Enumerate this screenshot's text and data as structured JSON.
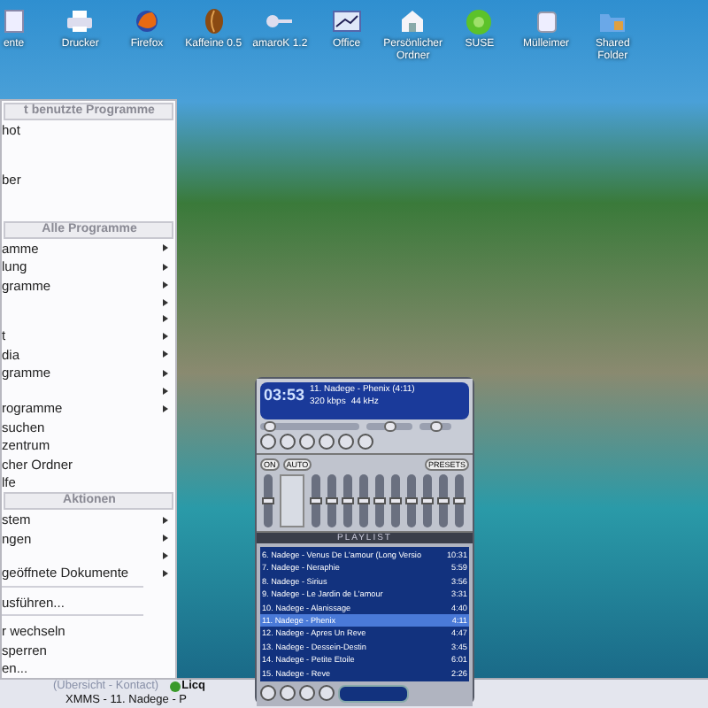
{
  "desktop_icons": [
    {
      "label": "ente"
    },
    {
      "label": "Drucker"
    },
    {
      "label": "Firefox"
    },
    {
      "label": "Kaffeine 0.5"
    },
    {
      "label": "amaroK 1.2"
    },
    {
      "label": "Office"
    },
    {
      "label": "Persönlicher Ordner"
    },
    {
      "label": "SUSE"
    },
    {
      "label": "Mülleimer"
    },
    {
      "label": "Shared Folder"
    }
  ],
  "start_menu": {
    "items": [
      {
        "kind": "header",
        "label": "t benutzte Programme"
      },
      {
        "kind": "item",
        "label": "hot",
        "submenu": false
      },
      {
        "kind": "item",
        "submenu": false
      },
      {
        "kind": "item",
        "submenu": false
      },
      {
        "kind": "item",
        "label": "ber",
        "submenu": false
      },
      {
        "kind": "item",
        "submenu": false
      },
      {
        "kind": "item",
        "submenu": false
      },
      {
        "kind": "header",
        "label": "Alle Programme"
      },
      {
        "kind": "item",
        "label": "amme",
        "submenu": true
      },
      {
        "kind": "item",
        "label": "lung",
        "submenu": true
      },
      {
        "kind": "item",
        "label": "gramme",
        "submenu": true
      },
      {
        "kind": "item",
        "submenu": true
      },
      {
        "kind": "item",
        "submenu": true
      },
      {
        "kind": "item",
        "label": "t",
        "submenu": true
      },
      {
        "kind": "item",
        "label": "dia",
        "submenu": true
      },
      {
        "kind": "item",
        "label": "gramme",
        "submenu": true
      },
      {
        "kind": "item",
        "submenu": true
      },
      {
        "kind": "item",
        "label": "rogramme",
        "submenu": true
      },
      {
        "kind": "item",
        "label": "suchen",
        "submenu": false
      },
      {
        "kind": "item",
        "label": "zentrum",
        "submenu": false
      },
      {
        "kind": "item",
        "label": "cher Ordner",
        "submenu": false
      },
      {
        "kind": "item",
        "label": "lfe",
        "submenu": false
      },
      {
        "kind": "header",
        "label": "Aktionen"
      },
      {
        "kind": "item",
        "label": "stem",
        "submenu": true
      },
      {
        "kind": "item",
        "label": "ngen",
        "submenu": true
      },
      {
        "kind": "item",
        "submenu": true
      },
      {
        "kind": "item",
        "label": "geöffnete Dokumente",
        "submenu": true
      },
      {
        "kind": "separator"
      },
      {
        "kind": "item",
        "label": "usführen...",
        "submenu": false
      },
      {
        "kind": "separator"
      },
      {
        "kind": "item",
        "label": "r wechseln",
        "submenu": false
      },
      {
        "kind": "item",
        "label": "sperren",
        "submenu": false
      },
      {
        "kind": "item",
        "label": "en...",
        "submenu": false
      }
    ]
  },
  "xmms": {
    "time": "03:53",
    "title": "11. Nadege - Phenix (4:11)",
    "bitrate": "320 kbps",
    "samplerate": "44 kHz",
    "seek": {
      "level": 0.05
    },
    "volume": {
      "level": 0.55
    },
    "balance": {
      "level": 0.5
    },
    "equalizer": {
      "buttons": [
        "ON",
        "AUTO",
        "PRESETS"
      ],
      "preamp": {
        "level": 0.5
      },
      "bands": [
        {
          "level": 0.5
        },
        {
          "level": 0.5
        },
        {
          "level": 0.5
        },
        {
          "level": 0.5
        },
        {
          "level": 0.5
        },
        {
          "level": 0.5
        },
        {
          "level": 0.5
        },
        {
          "level": 0.5
        },
        {
          "level": 0.5
        },
        {
          "level": 0.5
        }
      ]
    },
    "playlist": {
      "title": "PLAYLIST",
      "tracks": [
        {
          "title": "6. Nadege - Venus De L'amour (Long Versio",
          "duration": "10:31",
          "selected": false
        },
        {
          "title": "7. Nadege - Neraphie",
          "duration": "5:59",
          "selected": false
        },
        {
          "title": "8. Nadege - Sirius",
          "duration": "3:56",
          "selected": false
        },
        {
          "title": "9. Nadege - Le Jardin de L'amour",
          "duration": "3:31",
          "selected": false
        },
        {
          "title": "10. Nadege - Alanissage",
          "duration": "4:40",
          "selected": false
        },
        {
          "title": "11. Nadege - Phenix",
          "duration": "4:11",
          "selected": true
        },
        {
          "title": "12. Nadege - Apres Un Reve",
          "duration": "4:47",
          "selected": false
        },
        {
          "title": "13. Nadege - Dessein-Destin",
          "duration": "3:45",
          "selected": false
        },
        {
          "title": "14. Nadege - Petite Etoile",
          "duration": "6:01",
          "selected": false
        },
        {
          "title": "15. Nadege - Reve",
          "duration": "2:26",
          "selected": false
        }
      ]
    }
  },
  "taskbar": {
    "tasks": [
      {
        "label": "(Übersicht - Kontact)",
        "active": false
      },
      {
        "label": "Licq",
        "active": true
      },
      {
        "label": "XMMS - 11. Nadege - P",
        "active": false
      }
    ]
  }
}
